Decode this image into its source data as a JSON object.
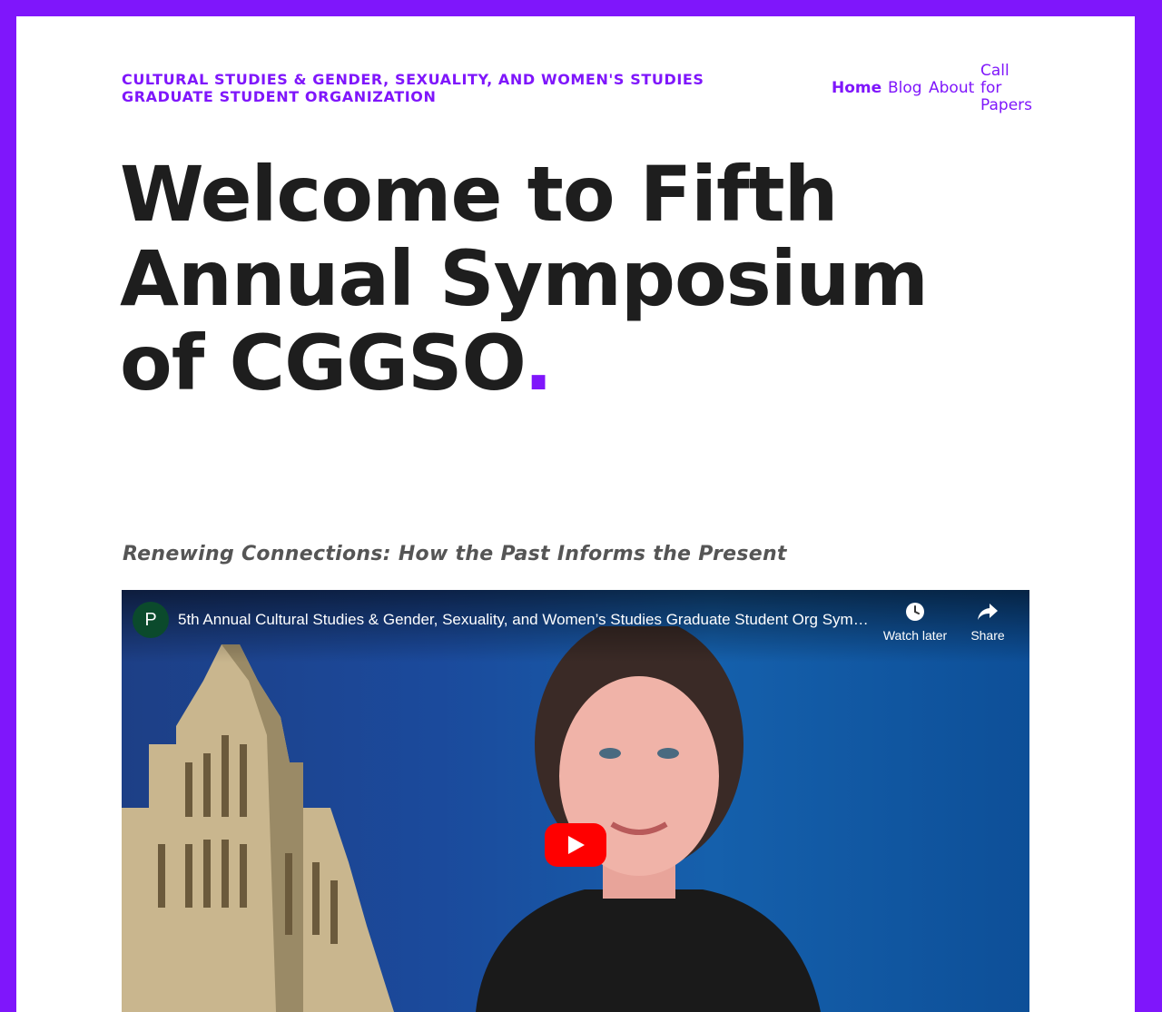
{
  "colors": {
    "accent": "#7f16fb",
    "heading": "#1e1e1e",
    "subtitle": "#555555",
    "youtube_red": "#ff0000"
  },
  "header": {
    "site_title": "CULTURAL STUDIES & GENDER, SEXUALITY, AND WOMEN'S STUDIES GRADUATE STUDENT ORGANIZATION",
    "nav": {
      "home": "Home",
      "blog": "Blog",
      "about": "About",
      "call_for_papers": "Call for Papers"
    }
  },
  "main": {
    "heading": "Welcome to Fifth Annual Symposium of CGGSO",
    "heading_dot": ".",
    "subtitle": "Renewing Connections: How the Past Informs the Present",
    "video": {
      "channel_avatar_letter": "P",
      "title": "5th Annual Cultural Studies & Gender, Sexuality, and Women’s Studies Graduate Student Org Symposium",
      "watch_later_label": "Watch later",
      "share_label": "Share",
      "icons": {
        "watch_later": "clock-icon",
        "share": "share-arrow-icon",
        "play": "play-icon"
      }
    }
  }
}
